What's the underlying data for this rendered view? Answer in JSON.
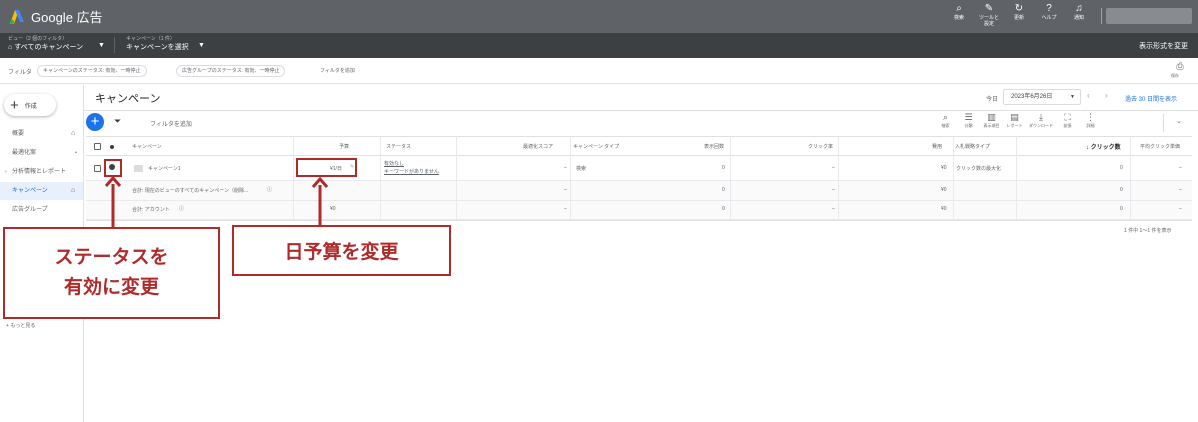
{
  "app": {
    "name": "Google 広告",
    "colors": {
      "topbar": "#5f6368",
      "subbar": "#3c4043",
      "accent": "#1a73e8",
      "annotation": "#b02a2a"
    }
  },
  "top_actions": [
    {
      "icon": "search-icon",
      "glyph": "⌕",
      "label": "検索"
    },
    {
      "icon": "wrench-icon",
      "glyph": "✎",
      "label": "ツールと\n設定"
    },
    {
      "icon": "refresh-icon",
      "glyph": "↻",
      "label": "更新"
    },
    {
      "icon": "help-icon",
      "glyph": "?",
      "label": "ヘルプ"
    },
    {
      "icon": "bell-icon",
      "glyph": "♫",
      "label": "通知"
    }
  ],
  "subbar": {
    "view_small": "ビュー（2 個のフィルタ）",
    "view_main": "すべてのキャンペーン",
    "campaign_small": "キャンペーン（1 件）",
    "campaign_main": "キャンペーンを選択",
    "display_format": "表示形式を変更"
  },
  "filterbar": {
    "label": "フィルタ",
    "chips": [
      "キャンペーンのステータス: 有効、一時停止",
      "広告グループのステータス: 有効、一時停止"
    ],
    "add_filter": "フィルタを追加",
    "save_label": "保存"
  },
  "sidebar": {
    "create_label": "作成",
    "items": [
      {
        "label": "概要"
      },
      {
        "label": "最適化案"
      },
      {
        "label": "分析情報とレポート"
      },
      {
        "label": "キャンペーン"
      },
      {
        "label": "広告グループ"
      }
    ],
    "more": "もっと見る"
  },
  "main": {
    "title": "キャンペーン",
    "today_label": "今日",
    "date": "2023年6月26日",
    "compare": "過去 30 日間を表示",
    "filter_add": "フィルタを追加",
    "tools": [
      {
        "icon": "search-icon",
        "glyph": "⌕",
        "label": "検索"
      },
      {
        "icon": "segment-icon",
        "glyph": "☰",
        "label": "分類"
      },
      {
        "icon": "columns-icon",
        "glyph": "▥",
        "label": "表示項目"
      },
      {
        "icon": "report-icon",
        "glyph": "▤",
        "label": "レポート"
      },
      {
        "icon": "download-icon",
        "glyph": "⤓",
        "label": "ダウンロード"
      },
      {
        "icon": "expand-icon",
        "glyph": "⛶",
        "label": "拡張"
      },
      {
        "icon": "more-icon",
        "glyph": "⋮",
        "label": "詳細"
      }
    ]
  },
  "table": {
    "headers": {
      "campaign": "キャンペーン",
      "budget": "予算",
      "status": "ステータス",
      "opt_score": "最適化スコア",
      "campaign_type": "キャンペーン タイプ",
      "impressions": "表示回数",
      "ctr": "クリック率",
      "cost": "費用",
      "bid_strategy": "入札戦略タイプ",
      "clicks": "↓ クリック数",
      "avg_cpc": "平均クリック単価"
    },
    "rows": [
      {
        "name": "キャンペーン1",
        "budget": "¥1/日",
        "status_line1": "有効なし",
        "status_line2": "キーワードがありません",
        "opt_score": "–",
        "campaign_type": "検索",
        "impressions": "0",
        "ctr": "–",
        "cost": "¥0",
        "bid_strategy": "クリック数の最大化",
        "clicks": "0",
        "avg_cpc": "–"
      },
      {
        "name": "合計: 現在のビューのすべてのキャンペーン（削除...",
        "budget": "",
        "opt_score": "–",
        "impressions": "0",
        "ctr": "–",
        "cost": "¥0",
        "clicks": "0",
        "avg_cpc": "–"
      },
      {
        "name": "合計: アカウント",
        "budget": "¥0",
        "opt_score": "–",
        "impressions": "0",
        "ctr": "–",
        "cost": "¥0",
        "clicks": "0",
        "avg_cpc": "–"
      }
    ],
    "pagination": "1 件中 1～1 件を表示"
  },
  "annotations": {
    "status_line1": "ステータスを",
    "status_line2": "有効に変更",
    "budget": "日予算を変更"
  }
}
